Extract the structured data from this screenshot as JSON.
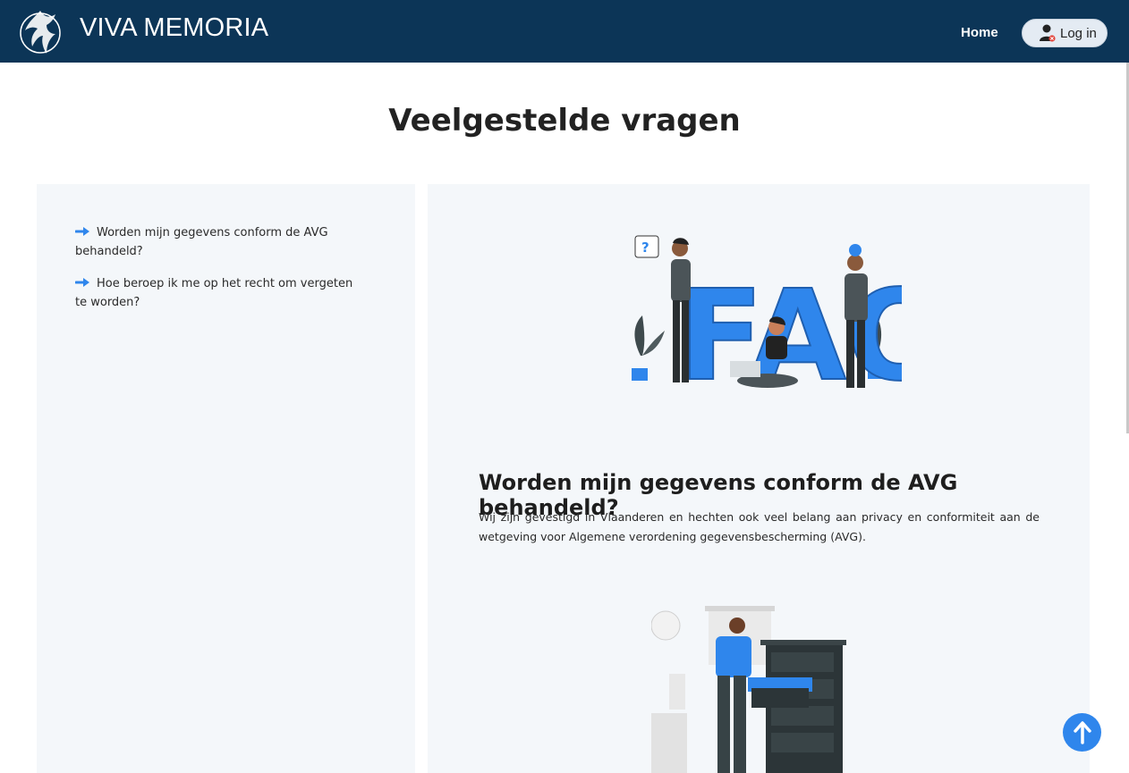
{
  "header": {
    "brand": "VIVA MEMORIA",
    "nav_home": "Home",
    "login_label": "Log in"
  },
  "page": {
    "title": "Veelgestelde vragen"
  },
  "sidebar": {
    "items": [
      {
        "label": "Worden mijn gegevens conform de AVG behandeld?"
      },
      {
        "label": "Hoe beroep ik me op het recht om vergeten te worden?"
      }
    ]
  },
  "answer": {
    "title": "Worden mijn gegevens conform de AVG behandeld?",
    "body": "Wij zijn gevestigd in Vlaanderen en hechten ook veel belang aan privacy en conformiteit aan de wetgeving voor Algemene verordening gegevensbescherming (AVG)."
  },
  "illustration": {
    "faq_letters": "FAQ"
  },
  "icons": {
    "logo": "phoenix-logo-icon",
    "login": "user-icon",
    "bullet": "arrow-right-icon",
    "back_to_top": "arrow-up-icon"
  },
  "colors": {
    "header_bg": "#0c3557",
    "accent": "#2f86ec",
    "panel_bg": "#f4f7fa"
  }
}
